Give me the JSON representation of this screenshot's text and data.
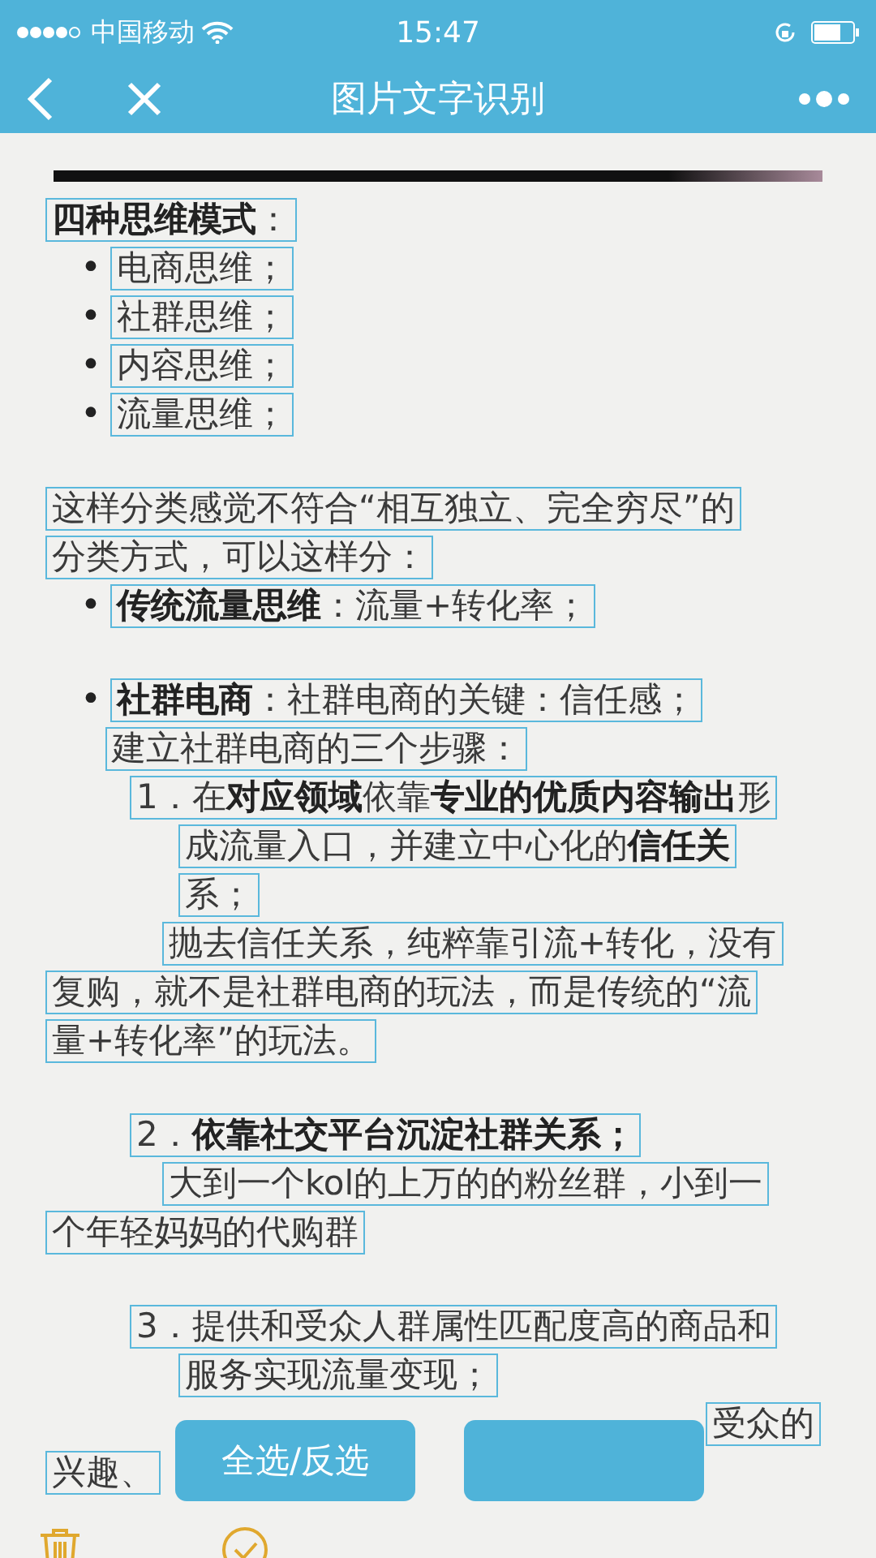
{
  "status_bar": {
    "carrier": "中国移动",
    "time": "15:47"
  },
  "nav_bar": {
    "title": "图片文字识别"
  },
  "blocks": [
    {
      "lines": [
        {
          "kind": "heading",
          "text": "**四种思维模式**："
        },
        {
          "kind": "bullet",
          "bullet": "•",
          "text": "电商思维；"
        },
        {
          "kind": "bullet",
          "bullet": "•",
          "text": "社群思维；"
        },
        {
          "kind": "bullet",
          "bullet": "•",
          "text": "内容思维；"
        },
        {
          "kind": "bullet",
          "bullet": "•",
          "text": "流量思维；"
        }
      ]
    },
    {
      "lines": [
        {
          "kind": "para",
          "text": "这样分类感觉不符合“相互独立、完全穷尽”的"
        },
        {
          "kind": "para",
          "text": "分类方式，可以这样分："
        },
        {
          "kind": "bullet",
          "bullet": "•",
          "text": "**传统流量思维**：流量+转化率；"
        }
      ]
    },
    {
      "lines": [
        {
          "kind": "bullet",
          "bullet": "•",
          "text": "**社群电商**：社群电商的关键：信任感；"
        },
        {
          "kind": "sub",
          "text": "建立社群电商的三个步骤："
        },
        {
          "kind": "step",
          "text": "1．在**对应领域**依靠**专业的优质内容输出**形"
        },
        {
          "kind": "step_cont",
          "text": "成流量入口，并建立中心化的**信任关**"
        },
        {
          "kind": "step_cont",
          "text": "系；"
        },
        {
          "kind": "step_body",
          "text": "抛去信任关系，纯粹靠引流+转化，没有"
        },
        {
          "kind": "para",
          "text": "复购，就不是社群电商的玩法，而是传统的“流"
        },
        {
          "kind": "para",
          "text": "量+转化率”的玩法。"
        }
      ]
    },
    {
      "lines": [
        {
          "kind": "step",
          "text": "2．**依靠社交平台沉淀社群关系；**"
        },
        {
          "kind": "step_body",
          "text": "大到一个kol的上万的的粉丝群，小到一"
        },
        {
          "kind": "para",
          "text": "个年轻妈妈的代购群"
        }
      ]
    },
    {
      "lines": [
        {
          "kind": "step",
          "text": "3．提供和受众人群属性匹配度高的商品和"
        },
        {
          "kind": "step_cont",
          "text": "服务实现流量变现；"
        },
        {
          "kind": "covered",
          "text": "受众的"
        },
        {
          "kind": "para",
          "text": "兴趣、"
        }
      ]
    }
  ],
  "buttons": [
    {
      "kind": "labeled",
      "label": "全选/反选"
    },
    {
      "kind": "covered"
    }
  ]
}
